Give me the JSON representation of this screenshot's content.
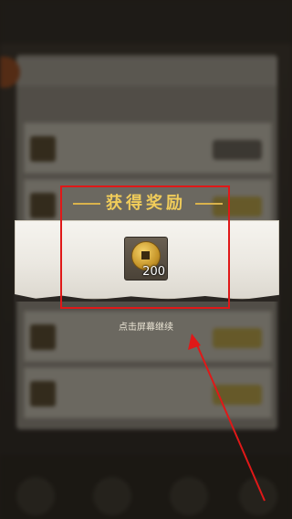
{
  "reward_popup": {
    "title": "获得奖励",
    "item": {
      "icon": "copper-coin-icon",
      "quantity": "200"
    },
    "continue_hint": "点击屏幕继续"
  },
  "colors": {
    "title_gold": "#f0cc5a",
    "highlight_red": "#e01818",
    "banner": "#ebe8e1"
  }
}
